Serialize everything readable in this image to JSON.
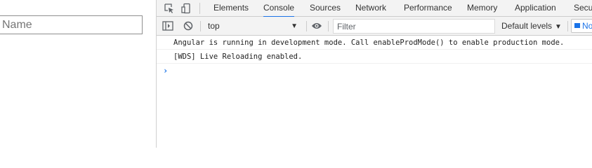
{
  "page": {
    "name_input": {
      "placeholder": "Name",
      "value": ""
    }
  },
  "devtools": {
    "tabs": [
      {
        "label": "Elements",
        "active": false
      },
      {
        "label": "Console",
        "active": true
      },
      {
        "label": "Sources",
        "active": false
      },
      {
        "label": "Network",
        "active": false
      },
      {
        "label": "Performance",
        "active": false
      },
      {
        "label": "Memory",
        "active": false
      },
      {
        "label": "Application",
        "active": false
      },
      {
        "label": "Secu",
        "active": false
      }
    ],
    "toolbar_icons": {
      "inspect": "inspect-element-icon",
      "device": "device-toolbar-icon",
      "sidebar": "sidebar-toggle-icon",
      "clear": "clear-console-icon",
      "eye": "live-expression-icon"
    },
    "toolbar": {
      "context": "top",
      "filter_placeholder": "Filter",
      "levels": "Default levels",
      "issues": "No"
    },
    "console": {
      "messages": [
        "Angular is running in development mode. Call enableProdMode() to enable production mode.",
        "[WDS] Live Reloading enabled."
      ],
      "prompt": "›"
    },
    "colors": {
      "accent": "#1a73e8",
      "toolbar_bg": "#f3f3f3",
      "border": "#cccccc"
    }
  }
}
